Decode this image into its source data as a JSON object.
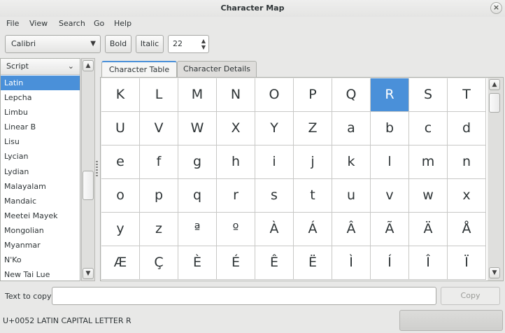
{
  "window": {
    "title": "Character Map",
    "close_glyph": "×"
  },
  "menu": [
    "File",
    "View",
    "Search",
    "Go",
    "Help"
  ],
  "toolbar": {
    "font": "Calibri",
    "bold_label": "Bold",
    "italic_label": "Italic",
    "size": "22"
  },
  "sidebar": {
    "header": "Script",
    "items": [
      "Latin",
      "Lepcha",
      "Limbu",
      "Linear B",
      "Lisu",
      "Lycian",
      "Lydian",
      "Malayalam",
      "Mandaic",
      "Meetei Mayek",
      "Mongolian",
      "Myanmar",
      "N'Ko",
      "New Tai Lue"
    ],
    "selected": "Latin"
  },
  "tabs": [
    "Character Table",
    "Character Details"
  ],
  "active_tab": "Character Table",
  "grid": {
    "chars": [
      "K",
      "L",
      "M",
      "N",
      "O",
      "P",
      "Q",
      "R",
      "S",
      "T",
      "U",
      "V",
      "W",
      "X",
      "Y",
      "Z",
      "a",
      "b",
      "c",
      "d",
      "e",
      "f",
      "g",
      "h",
      "i",
      "j",
      "k",
      "l",
      "m",
      "n",
      "o",
      "p",
      "q",
      "r",
      "s",
      "t",
      "u",
      "v",
      "w",
      "x",
      "y",
      "z",
      "ª",
      "º",
      "À",
      "Á",
      "Â",
      "Ã",
      "Ä",
      "Å",
      "Æ",
      "Ç",
      "È",
      "É",
      "Ê",
      "Ë",
      "Ì",
      "Í",
      "Î",
      "Ï"
    ],
    "selected": "R"
  },
  "copy": {
    "label": "Text to copy:",
    "value": "",
    "button": "Copy"
  },
  "status": "U+0052 LATIN CAPITAL LETTER R",
  "colors": {
    "accent": "#4a90d9"
  },
  "icons": {
    "close": "close-icon",
    "combo_arrow": "chevron-down-icon",
    "scroll_up": "chevron-up-icon",
    "scroll_down": "chevron-down-icon"
  }
}
